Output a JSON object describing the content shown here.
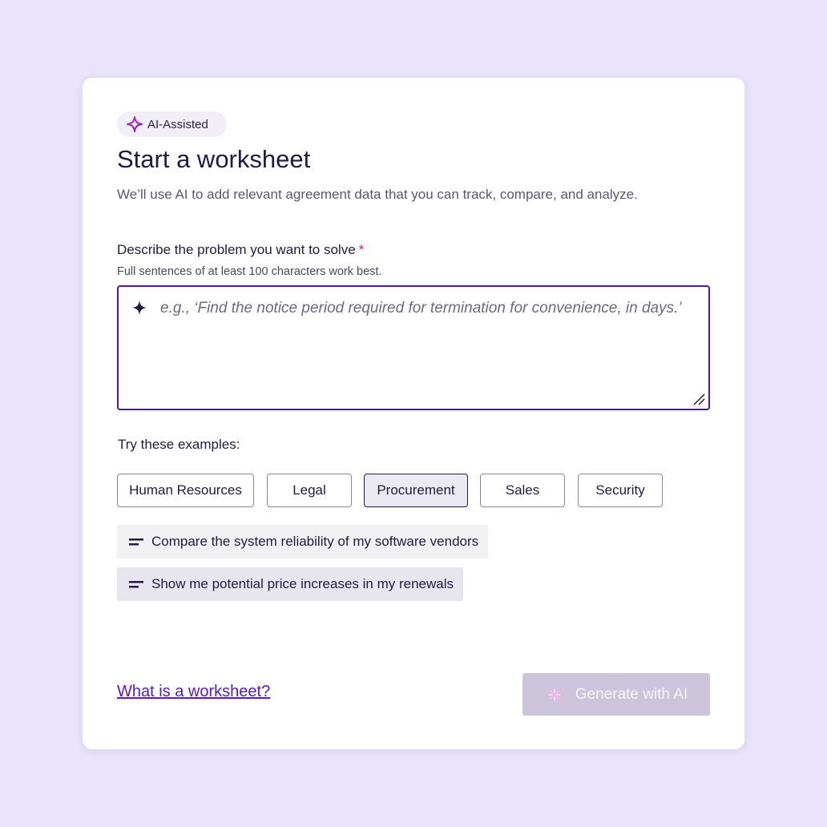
{
  "badge": {
    "label": "AI-Assisted",
    "icon": "sparkle-icon"
  },
  "title": "Start a worksheet",
  "subtitle": "We’ll use AI to add relevant agreement data that you can track, compare, and analyze.",
  "problem_field": {
    "label": "Describe the problem you want to solve",
    "required_mark": "*",
    "hint": "Full sentences of at least 100 characters work best.",
    "placeholder": "e.g., ‘Find the notice period required for termination for convenience, in days.’",
    "value": ""
  },
  "examples": {
    "label": "Try these examples:",
    "categories": [
      {
        "label": "Human Resources",
        "selected": false
      },
      {
        "label": "Legal",
        "selected": false
      },
      {
        "label": "Procurement",
        "selected": true
      },
      {
        "label": "Sales",
        "selected": false
      },
      {
        "label": "Security",
        "selected": false
      }
    ],
    "suggestions": [
      {
        "text": "Compare the system reliability of my software vendors"
      },
      {
        "text": "Show me potential price increases in my renewals"
      }
    ]
  },
  "footer": {
    "help_link": "What is a worksheet?",
    "generate_button": "Generate with AI",
    "generate_disabled": true
  },
  "colors": {
    "background": "#e9e3fc",
    "accent": "#4a1aa6",
    "link": "#5a16c9",
    "required": "#c6166e",
    "button_disabled": "#cbc4da"
  }
}
